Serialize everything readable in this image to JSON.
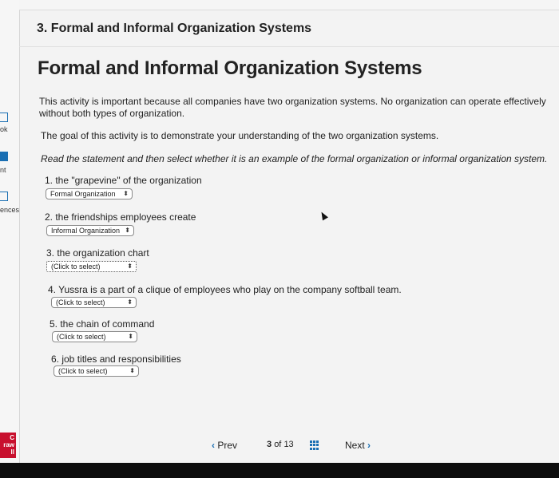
{
  "sidebar": {
    "items": [
      {
        "label": "ok"
      },
      {
        "label": "nt"
      },
      {
        "label": "ences"
      }
    ],
    "logo_text": "C raw ll"
  },
  "header": {
    "title": "3. Formal and Informal Organization Systems"
  },
  "activity": {
    "title": "Formal and Informal Organization Systems",
    "intro": "This activity is important because all companies have two organization systems. No organization can operate effectively without both types of organization.",
    "goal": "The goal of this activity is to demonstrate your understanding of the two organization systems.",
    "instruction": "Read the statement and then select whether it is an example of the formal organization or informal organization system."
  },
  "questions": [
    {
      "text": "1. the \"grapevine\" of the organization",
      "selected": "Formal Organization"
    },
    {
      "text": "2. the friendships employees create",
      "selected": "Informal Organization"
    },
    {
      "text": "3. the organization chart",
      "selected": "(Click to select)"
    },
    {
      "text": "4. Yussra is a part of a clique of employees who play on the company softball team.",
      "selected": "(Click to select)"
    },
    {
      "text": "5. the chain of command",
      "selected": "(Click to select)"
    },
    {
      "text": "6. job titles and responsibilities",
      "selected": "(Click to select)"
    }
  ],
  "select_arrow": "⬍",
  "pager": {
    "prev_chevron": "‹",
    "prev_label": "Prev",
    "current": "3",
    "of_label": "of",
    "total": "13",
    "next_label": "Next",
    "next_chevron": "›"
  }
}
